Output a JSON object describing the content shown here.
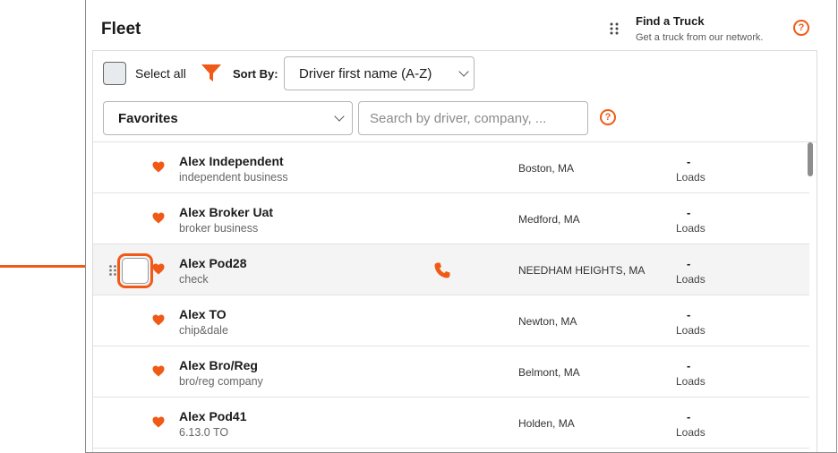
{
  "header": {
    "title": "Fleet",
    "find_truck_title": "Find a Truck",
    "find_truck_subtitle": "Get a truck from our network.",
    "help_glyph": "?"
  },
  "toolbar": {
    "select_all_label": "Select all",
    "sort_by_label": "Sort By:",
    "sort_value": "Driver first name (A-Z)",
    "favorites_value": "Favorites",
    "search_placeholder": "Search by driver, company, ...",
    "help_glyph": "?"
  },
  "colors": {
    "accent": "#f05a16",
    "text": "#1b1b1b",
    "row_highlight": "#f4f4f4"
  },
  "rows": [
    {
      "name": "Alex Independent",
      "company": "independent business",
      "location": "Boston, MA",
      "loads_value": "-",
      "loads_label": "Loads"
    },
    {
      "name": "Alex Broker Uat",
      "company": "broker business",
      "location": "Medford, MA",
      "loads_value": "-",
      "loads_label": "Loads"
    },
    {
      "name": "Alex Pod28",
      "company": "check",
      "location": "NEEDHAM HEIGHTS, MA",
      "loads_value": "-",
      "loads_label": "Loads"
    },
    {
      "name": "Alex TO",
      "company": "chip&dale",
      "location": "Newton, MA",
      "loads_value": "-",
      "loads_label": "Loads"
    },
    {
      "name": "Alex Bro/Reg",
      "company": "bro/reg company",
      "location": "Belmont, MA",
      "loads_value": "-",
      "loads_label": "Loads"
    },
    {
      "name": "Alex Pod41",
      "company": "6.13.0 TO",
      "location": "Holden, MA",
      "loads_value": "-",
      "loads_label": "Loads"
    }
  ]
}
